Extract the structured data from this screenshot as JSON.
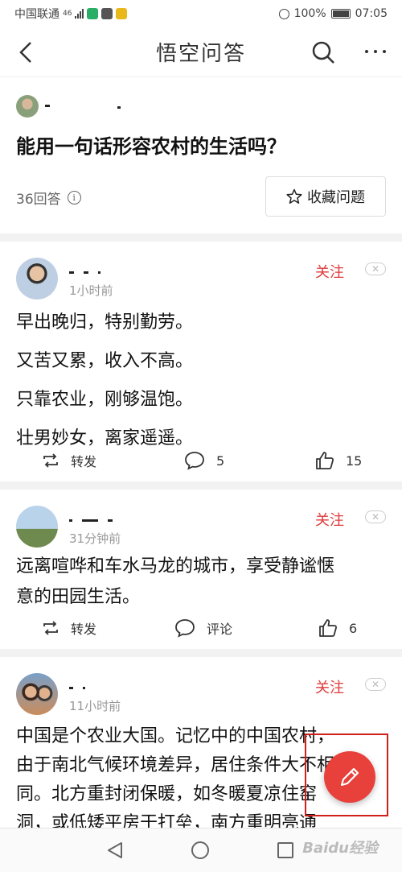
{
  "status_bar": {
    "carrier": "中国联通",
    "network": "46",
    "battery": "100%",
    "time": "07:05"
  },
  "header": {
    "title": "悟空问答"
  },
  "question": {
    "title": "能用一句话形容农村的生活吗？",
    "answer_count": "36回答",
    "favorite_label": "收藏问题"
  },
  "answers": [
    {
      "time": "1小时前",
      "follow_label": "关注",
      "lines": [
        "早出晚归，特别勤劳。",
        "又苦又累，收入不高。",
        "只靠农业，刚够温饱。",
        "壮男妙女，离家遥遥。"
      ],
      "repost_label": "转发",
      "comment_value": "5",
      "like_value": "15"
    },
    {
      "time": "31分钟前",
      "follow_label": "关注",
      "lines": [
        "远离喧哗和车水马龙的城市，享受静谧惬",
        "意的田园生活。"
      ],
      "repost_label": "转发",
      "comment_value": "评论",
      "like_value": "6"
    },
    {
      "time": "11小时前",
      "follow_label": "关注",
      "lines": [
        "中国是个农业大国。记忆中的中国农村，",
        "由于南北气候环境差异，居住条件大不相",
        "同。北方重封闭保暖，如冬暖夏凉住窑",
        "洞，或低矮平房干打垒，南方重明亮通"
      ]
    }
  ],
  "watermark": "Baidu经验",
  "colors": {
    "accent_red": "#e03a3a",
    "fab_red": "#e8403a",
    "highlight_frame": "#d0201a"
  },
  "icons": {
    "back": "chevron-left-icon",
    "search": "search-icon",
    "more": "more-dots-icon",
    "info": "info-icon",
    "star": "star-outline-icon",
    "repost": "repost-icon",
    "comment": "comment-bubble-icon",
    "like": "thumb-up-icon",
    "fab": "pencil-icon"
  }
}
